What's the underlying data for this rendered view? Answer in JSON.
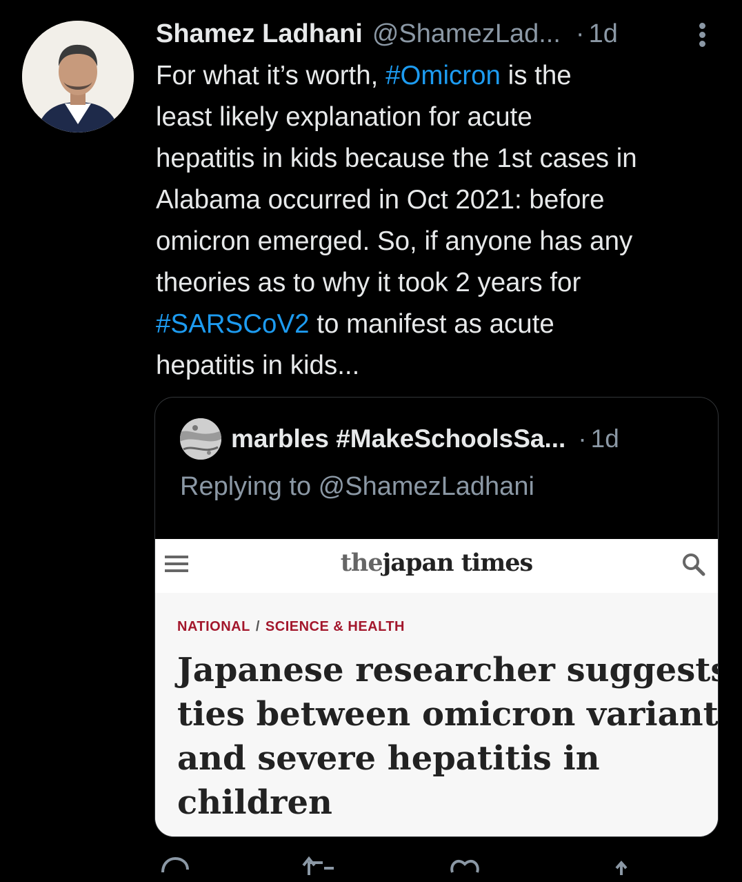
{
  "tweet": {
    "author_name": "Shamez Ladhani",
    "author_handle": "@ShamezLad...",
    "time_sep": "·",
    "time": "1d",
    "avatar_icon": "profile-photo",
    "lines": [
      {
        "segments": [
          {
            "text": "For what it’s worth, "
          },
          {
            "text": "#Omicron",
            "link": true
          },
          {
            "text": " is the"
          }
        ]
      },
      {
        "segments": [
          {
            "text": "least likely explanation for acute"
          }
        ]
      },
      {
        "segments": [
          {
            "text": "hepatitis in kids because the 1st cases in"
          }
        ]
      },
      {
        "segments": [
          {
            "text": "Alabama occurred in Oct 2021: before"
          }
        ]
      },
      {
        "segments": [
          {
            "text": "omicron emerged. So, if anyone has any"
          }
        ]
      },
      {
        "segments": [
          {
            "text": "theories as to why it took 2 years for"
          }
        ]
      },
      {
        "segments": [
          {
            "text": "#SARSCoV2",
            "link": true
          },
          {
            "text": " to manifest as acute"
          }
        ]
      },
      {
        "segments": [
          {
            "text": "hepatitis in kids..."
          }
        ]
      }
    ]
  },
  "quoted": {
    "author_name": "marbles #MakeSchoolsSa...",
    "time_sep": "·",
    "time": "1d",
    "replying_to": "Replying to @ShamezLadhani",
    "image": {
      "logo_the": "the",
      "logo_rest": "japan times",
      "section_primary": "NATIONAL",
      "section_sep": "/",
      "section_secondary": "SCIENCE & HEALTH",
      "headline_lines": [
        "Japanese researcher suggests",
        "ties between omicron variant",
        "and severe hepatitis in",
        "children"
      ]
    }
  },
  "colors": {
    "background": "#000000",
    "link": "#1d9bf0",
    "muted": "#8b98a5",
    "text": "#e7e9ea",
    "section_red": "#a3172c"
  },
  "actions": {
    "reply_icon": "reply-icon",
    "retweet_icon": "retweet-icon",
    "like_icon": "like-icon",
    "share_icon": "share-icon"
  }
}
